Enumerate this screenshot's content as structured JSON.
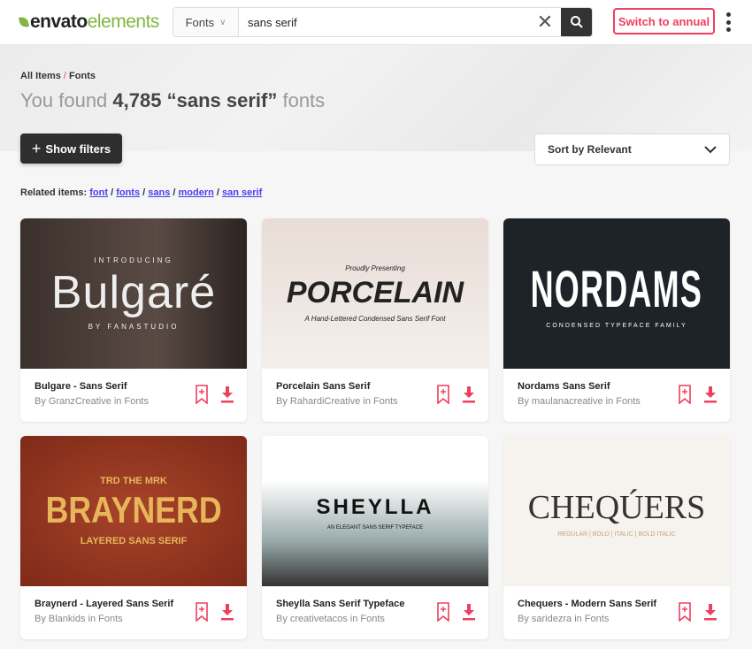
{
  "header": {
    "logo_bold": "envato",
    "logo_light": "elements",
    "category": "Fonts",
    "search_value": "sans serif",
    "search_placeholder": "Search",
    "switch_label": "Switch to annual"
  },
  "breadcrumb": {
    "items": [
      "All Items",
      "Fonts"
    ],
    "sep": "/"
  },
  "results": {
    "prefix": "You found",
    "count": "4,785",
    "query": "“sans serif”",
    "suffix": "fonts"
  },
  "filters_label": "Show filters",
  "sort_label": "Sort by Relevant",
  "related": {
    "label": "Related items:",
    "links": [
      "font",
      "fonts",
      "sans",
      "modern",
      "san serif"
    ]
  },
  "colors": {
    "accent": "#f03e5f",
    "brand": "#82b541",
    "link": "#4a3ff0"
  },
  "cards": [
    {
      "name": "Bulgare - Sans Serif",
      "author": "By GranzCreative in Fonts",
      "thumb": {
        "top": "INTRODUCING",
        "main": "Bulgaré",
        "bottom": "BY FANASTUDIO"
      }
    },
    {
      "name": "Porcelain Sans Serif",
      "author": "By RahardiCreative in Fonts",
      "thumb": {
        "top": "Proudly Presenting",
        "main": "PORCELAIN",
        "bottom": "A Hand-Lettered Condensed Sans Serif Font"
      }
    },
    {
      "name": "Nordams Sans Serif",
      "author": "By maulanacreative in Fonts",
      "thumb": {
        "top": "",
        "main": "NORDAMS",
        "bottom": "CONDENSED TYPEFACE FAMILY"
      }
    },
    {
      "name": "Braynerd - Layered Sans Serif",
      "author": "By Blankids in Fonts",
      "thumb": {
        "top": "TRD THE MRK",
        "main": "BRAYNERD",
        "bottom": "LAYERED SANS SERIF"
      }
    },
    {
      "name": "Sheylla Sans Serif Typeface",
      "author": "By creativetacos in Fonts",
      "thumb": {
        "top": "",
        "main": "SHEYLLA",
        "bottom": "AN ELEGANT SANS SERIF TYPEFACE"
      }
    },
    {
      "name": "Chequers - Modern Sans Serif",
      "author": "By saridezra in Fonts",
      "thumb": {
        "top": "",
        "main": "CHEQÚERS",
        "bottom": "REGULAR | BOLD | ITALIC | BOLD ITALIC"
      }
    }
  ]
}
